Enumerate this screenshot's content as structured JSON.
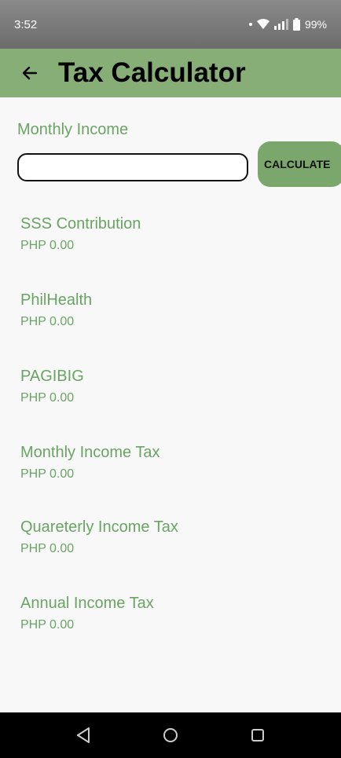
{
  "status_bar": {
    "time": "3:52",
    "battery": "99%",
    "icons": [
      "dot-icon",
      "wifi-icon",
      "signal-icon",
      "battery-icon"
    ]
  },
  "app_bar": {
    "title": "Tax Calculator",
    "back_icon": "arrow-left-icon",
    "color": "#86ae76"
  },
  "form": {
    "income_label": "Monthly Income",
    "income_value": "",
    "calculate_label": "CALCULATE"
  },
  "results": [
    {
      "label": "SSS Contribution",
      "value": "PHP 0.00"
    },
    {
      "label": "PhilHealth",
      "value": "PHP 0.00"
    },
    {
      "label": "PAGIBIG",
      "value": "PHP 0.00"
    },
    {
      "label": "Monthly Income Tax",
      "value": "PHP 0.00"
    },
    {
      "label": "Quareterly Income Tax",
      "value": "PHP 0.00"
    },
    {
      "label": "Annual Income Tax",
      "value": "PHP 0.00"
    }
  ],
  "nav_bar": {
    "icons": [
      "back-triangle-icon",
      "home-circle-icon",
      "recents-square-icon"
    ]
  },
  "colors": {
    "accent_text": "#6aa464",
    "button": "#7ba76d"
  }
}
